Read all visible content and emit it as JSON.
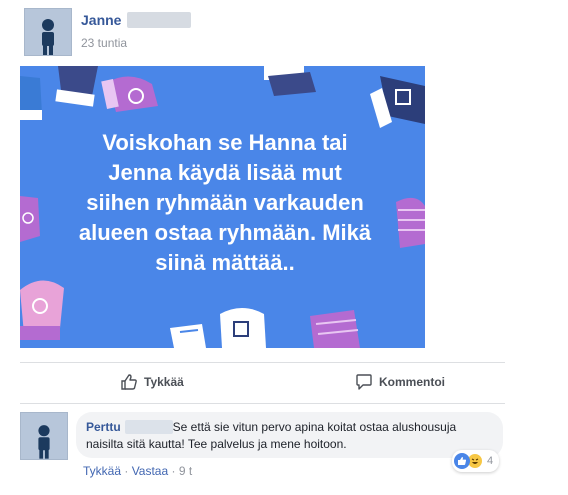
{
  "post": {
    "author": "Janne",
    "timestamp": "23 tuntia",
    "image_text": "Voiskohan se Hanna tai\nJenna käydä lisää mut\nsiihen ryhmään varkauden\nalueen ostaa ryhmään. Mikä\nsiinä mättää..",
    "image_bg": "#4a86e8"
  },
  "actions": {
    "like_label": "Tykkää",
    "comment_label": "Kommentoi"
  },
  "comment": {
    "author": "Perttu",
    "text_line1": "Se että sie vitun pervo apina koitat ostaa alushousuja",
    "text_line2": "naisilta sitä kautta! Tee palvelus ja mene hoitoon.",
    "like_link": "Tykkää",
    "separator": " · ",
    "reply_link": "Vastaa",
    "age": "9 t",
    "reaction_count": "4",
    "reaction_icons": [
      "like-icon",
      "haha-icon"
    ]
  },
  "colors": {
    "link": "#365899",
    "meta": "#90949c"
  }
}
